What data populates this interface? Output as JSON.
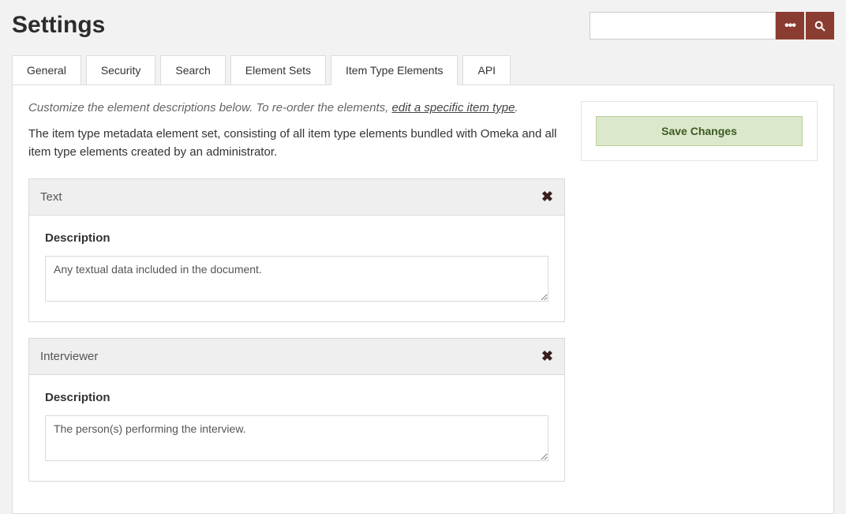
{
  "page": {
    "title": "Settings"
  },
  "search": {
    "placeholder": ""
  },
  "tabs": [
    {
      "label": "General"
    },
    {
      "label": "Security"
    },
    {
      "label": "Search"
    },
    {
      "label": "Element Sets"
    },
    {
      "label": "Item Type Elements"
    },
    {
      "label": "API"
    }
  ],
  "intro": {
    "lead": "Customize the element descriptions below. To re-order the elements, ",
    "link": "edit a specific item type",
    "tail": ".",
    "body": "The item type metadata element set, consisting of all item type elements bundled with Omeka and all item type elements created by an administrator."
  },
  "fields": [
    {
      "title": "Text",
      "descLabel": "Description",
      "descValue": "Any textual data included in the document."
    },
    {
      "title": "Interviewer",
      "descLabel": "Description",
      "descValue": "The person(s) performing the interview."
    }
  ],
  "actions": {
    "save": "Save Changes"
  }
}
